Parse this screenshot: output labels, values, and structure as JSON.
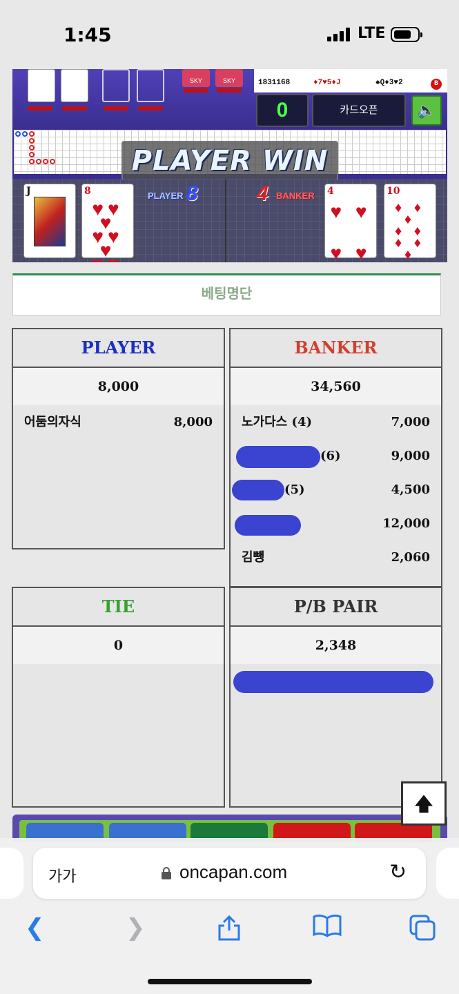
{
  "status_bar": {
    "time": "1:45",
    "network": "LTE"
  },
  "game": {
    "results": [
      {
        "id": "1831168",
        "cards_player": "♦7♥5♦J",
        "cards_banker": "♠Q♦3♥2",
        "winner": "B"
      }
    ],
    "score": "0",
    "card_open_label": "카드오픈",
    "sky_label": "SKY",
    "win_banner": "PLAYER WIN",
    "player_label": "PLAYER",
    "player_score": "8",
    "banker_label": "BANKER",
    "banker_score": "4",
    "player_cards": [
      {
        "rank": "J",
        "suit": "♠"
      },
      {
        "rank": "8",
        "suit": "♥"
      }
    ],
    "banker_cards": [
      {
        "rank": "4",
        "suit": "♥"
      },
      {
        "rank": "10",
        "suit": "♦"
      }
    ]
  },
  "betting_list": {
    "title": "베팅명단"
  },
  "panels": {
    "player": {
      "title": "PLAYER",
      "title_color": "#1a30c0",
      "total": "8,000",
      "rows": [
        {
          "name": "어둠의자식",
          "amount": "8,000"
        }
      ]
    },
    "banker": {
      "title": "BANKER",
      "title_color": "#d04030",
      "total": "34,560",
      "rows": [
        {
          "name": "노가다스 (4)",
          "amount": "7,000"
        },
        {
          "name": "(6)",
          "amount": "9,000"
        },
        {
          "name": "(5)",
          "amount": "4,500"
        },
        {
          "name": "",
          "amount": "12,000"
        },
        {
          "name": "김뺑",
          "amount": "2,060"
        }
      ]
    },
    "tie": {
      "title": "TIE",
      "title_color": "#3aa030",
      "total": "0"
    },
    "pair": {
      "title": "P/B PAIR",
      "title_color": "#333333",
      "total": "2,348"
    }
  },
  "browser": {
    "text_size_label": "가가",
    "domain": "oncapan.com"
  },
  "icons": {
    "back": "chevron-left-icon",
    "forward": "chevron-right-icon",
    "share": "share-icon",
    "bookmarks": "book-icon",
    "tabs": "tabs-icon",
    "reload": "reload-icon",
    "lock": "lock-icon",
    "scroll_top": "arrow-up-icon",
    "sound": "speaker-icon"
  }
}
